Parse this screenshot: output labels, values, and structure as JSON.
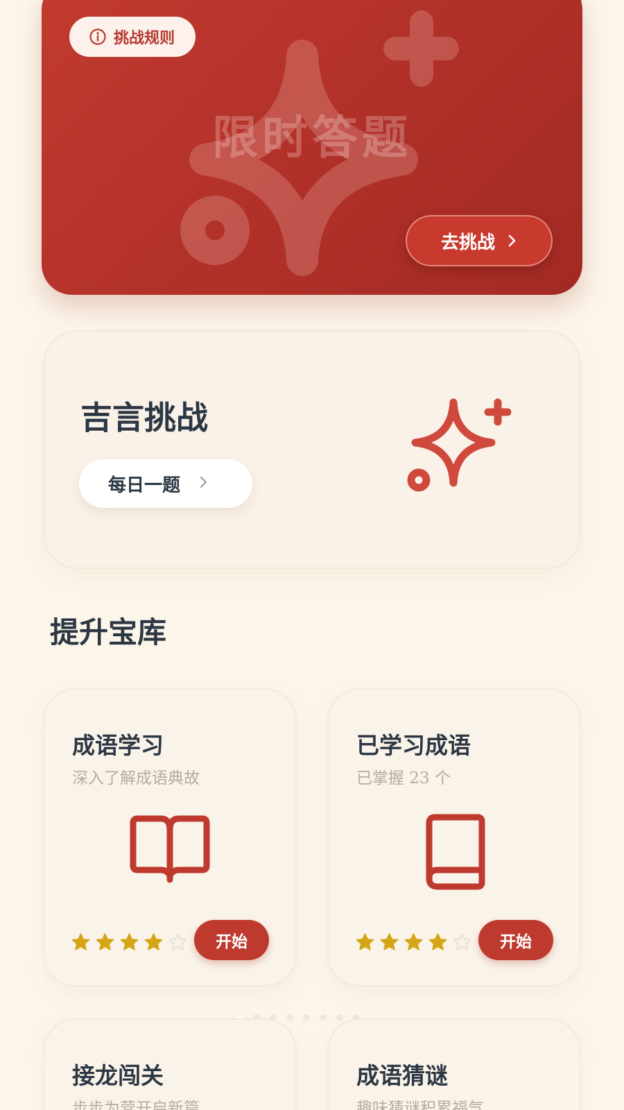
{
  "colors": {
    "primary_red": "#c23b2f",
    "background": "#fcf6ea",
    "star_gold": "#d4a514",
    "text_dark": "#2c3744",
    "text_muted": "#b4aca1"
  },
  "banner": {
    "rules_label": "挑战规则",
    "rules_icon": "info-icon",
    "title": "限时答题",
    "go_label": "去挑战",
    "go_icon": "chevron-right-icon",
    "decoration_icon": "sparkle-icon"
  },
  "jiyan": {
    "title": "吉言挑战",
    "daily_label": "每日一题",
    "daily_icon": "chevron-right-icon",
    "icon": "sparkle-icon"
  },
  "library": {
    "section_title": "提升宝库",
    "cards": [
      {
        "title": "成语学习",
        "subtitle": "深入了解成语典故",
        "icon": "open-book-icon",
        "rating": 4,
        "max_rating": 5,
        "button": "开始"
      },
      {
        "title": "已学习成语",
        "subtitle": "已掌握 23 个",
        "icon": "closed-book-icon",
        "rating": 4,
        "max_rating": 5,
        "button": "开始"
      },
      {
        "title": "接龙闯关",
        "subtitle": "步步为营开启新篇"
      },
      {
        "title": "成语猜谜",
        "subtitle": "趣味猜谜积累福气"
      }
    ],
    "pager": {
      "count": 8,
      "active_index": 0
    }
  }
}
